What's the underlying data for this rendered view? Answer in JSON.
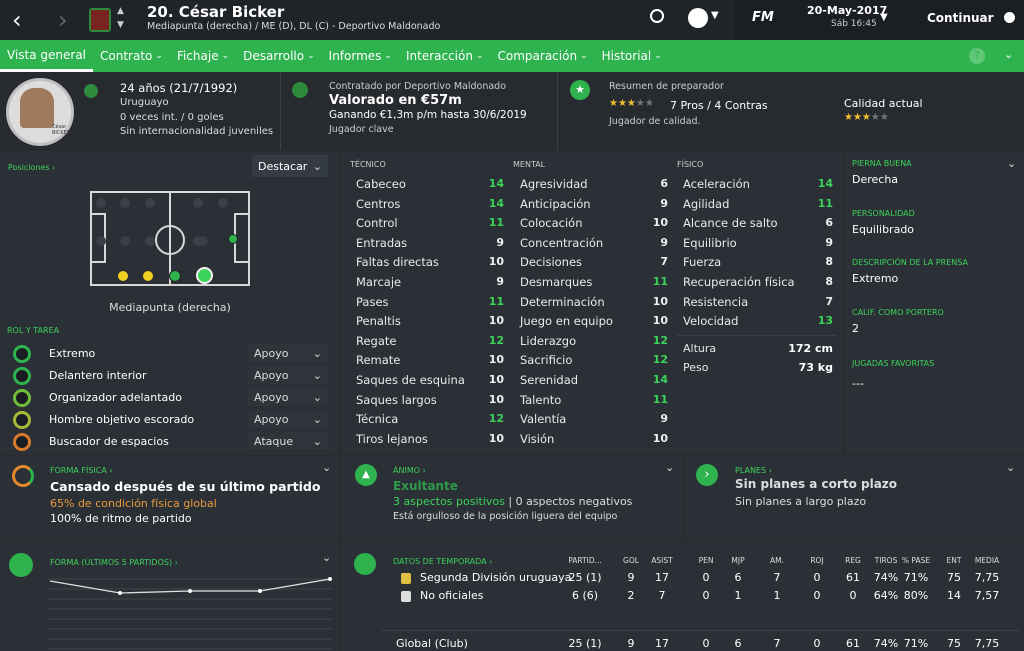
{
  "header": {
    "title": "20. César Bicker",
    "subtitle": "Mediapunta (derecha) / ME (D), DL (C) - Deportivo Maldonado",
    "date": "20-May-2017",
    "day_time": "Sáb 16:45",
    "continue_label": "Continuar",
    "fm_logo": "FM"
  },
  "nav": [
    {
      "label": "Vista general"
    },
    {
      "label": "Contrato"
    },
    {
      "label": "Fichaje"
    },
    {
      "label": "Desarrollo"
    },
    {
      "label": "Informes"
    },
    {
      "label": "Interacción"
    },
    {
      "label": "Comparación"
    },
    {
      "label": "Historial"
    }
  ],
  "player": {
    "age": "24 años (21/7/1992)",
    "nationality": "Uruguayo",
    "caps": "0 veces int. / 0 goles",
    "youth": "Sin internacionalidad juveniles",
    "card_name": "César BICKER"
  },
  "contract": {
    "hired_by": "Contratado por Deportivo Maldonado",
    "value": "Valorado en €57m",
    "wage": "Ganando €1,3m p/m hasta 30/6/2019",
    "status": "Jugador clave"
  },
  "coach": {
    "title": "Resumen de preparador",
    "pros": "7 Pros / 4 Contras",
    "desc": "Jugador de calidad.",
    "current_label": "Calidad actual"
  },
  "positions": {
    "title": "Posiciones",
    "highlight_label": "Destacar",
    "position_name": "Mediapunta (derecha)"
  },
  "roles": {
    "title": "ROL Y TAREA",
    "items": [
      {
        "name": "Extremo",
        "duty": "Apoyo"
      },
      {
        "name": "Delantero interior",
        "duty": "Apoyo"
      },
      {
        "name": "Organizador adelantado",
        "duty": "Apoyo"
      },
      {
        "name": "Hombre objetivo escorado",
        "duty": "Apoyo"
      },
      {
        "name": "Buscador de espacios",
        "duty": "Ataque"
      }
    ]
  },
  "attributes": {
    "technical_title": "TÉCNICO",
    "mental_title": "MENTAL",
    "physical_title": "FÍSICO",
    "technical": [
      {
        "n": "Cabeceo",
        "v": "14"
      },
      {
        "n": "Centros",
        "v": "14"
      },
      {
        "n": "Control",
        "v": "11"
      },
      {
        "n": "Entradas",
        "v": "9"
      },
      {
        "n": "Faltas directas",
        "v": "10"
      },
      {
        "n": "Marcaje",
        "v": "9"
      },
      {
        "n": "Pases",
        "v": "11"
      },
      {
        "n": "Penaltis",
        "v": "10"
      },
      {
        "n": "Regate",
        "v": "12"
      },
      {
        "n": "Remate",
        "v": "10"
      },
      {
        "n": "Saques de esquina",
        "v": "10"
      },
      {
        "n": "Saques largos",
        "v": "10"
      },
      {
        "n": "Técnica",
        "v": "12"
      },
      {
        "n": "Tiros lejanos",
        "v": "10"
      }
    ],
    "mental": [
      {
        "n": "Agresividad",
        "v": "6"
      },
      {
        "n": "Anticipación",
        "v": "9"
      },
      {
        "n": "Colocación",
        "v": "10"
      },
      {
        "n": "Concentración",
        "v": "9"
      },
      {
        "n": "Decisiones",
        "v": "7"
      },
      {
        "n": "Desmarques",
        "v": "11"
      },
      {
        "n": "Determinación",
        "v": "10"
      },
      {
        "n": "Juego en equipo",
        "v": "10"
      },
      {
        "n": "Liderazgo",
        "v": "12"
      },
      {
        "n": "Sacrificio",
        "v": "12"
      },
      {
        "n": "Serenidad",
        "v": "14"
      },
      {
        "n": "Talento",
        "v": "11"
      },
      {
        "n": "Valentía",
        "v": "9"
      },
      {
        "n": "Visión",
        "v": "10"
      }
    ],
    "physical": [
      {
        "n": "Aceleración",
        "v": "14"
      },
      {
        "n": "Agilidad",
        "v": "11"
      },
      {
        "n": "Alcance de salto",
        "v": "6"
      },
      {
        "n": "Equilibrio",
        "v": "9"
      },
      {
        "n": "Fuerza",
        "v": "8"
      },
      {
        "n": "Recuperación física",
        "v": "8"
      },
      {
        "n": "Resistencia",
        "v": "7"
      },
      {
        "n": "Velocidad",
        "v": "13"
      }
    ],
    "height_label": "Altura",
    "height": "172 cm",
    "weight_label": "Peso",
    "weight": "73 kg"
  },
  "info": [
    {
      "label": "PIERNA BUENA",
      "value": "Derecha"
    },
    {
      "label": "PERSONALIDAD",
      "value": "Equilibrado"
    },
    {
      "label": "DESCRIPCIÓN DE LA PRENSA",
      "value": "Extremo"
    },
    {
      "label": "CALIF. COMO PORTERO",
      "value": "2"
    },
    {
      "label": "JUGADAS FAVORITAS",
      "value": "---"
    }
  ],
  "fitness": {
    "title": "FORMA FÍSICA",
    "headline": "Cansado después de su último partido",
    "condition": "65% de condición física global",
    "rhythm": "100% de ritmo de partido"
  },
  "morale": {
    "title": "ÁNIMO",
    "state": "Exultante",
    "positives": "3 aspectos positivos",
    "negatives": "0 aspectos negativos",
    "note": "Está orgulloso de la posición liguera del equipo"
  },
  "plans": {
    "title": "PLANES",
    "short": "Sin planes a corto plazo",
    "long": "Sin planes a largo plazo"
  },
  "form": {
    "title": "FORMA (ÚLTIMOS 5 PARTIDOS)"
  },
  "season": {
    "title": "DATOS DE TEMPORADA",
    "headers": [
      "PARTID...",
      "GOL",
      "ASIST",
      "PEN",
      "MJP",
      "AM.",
      "ROJ",
      "REG",
      "TIROS",
      "% PASE",
      "ENT",
      "MEDIA"
    ],
    "rows": [
      {
        "name": "Segunda División uruguaya",
        "vals": [
          "25 (1)",
          "9",
          "17",
          "0",
          "6",
          "7",
          "0",
          "61",
          "74%",
          "71%",
          "75",
          "7,75"
        ]
      },
      {
        "name": "No oficiales",
        "vals": [
          "6 (6)",
          "2",
          "7",
          "0",
          "1",
          "1",
          "0",
          "0",
          "64%",
          "80%",
          "14",
          "7,57"
        ]
      }
    ],
    "total": {
      "name": "Global (Club)",
      "vals": [
        "25 (1)",
        "9",
        "17",
        "0",
        "6",
        "7",
        "0",
        "61",
        "74%",
        "71%",
        "75",
        "7,75"
      ]
    }
  },
  "colors": {
    "accent": "#2eb34f",
    "bg": "#262a2f"
  }
}
